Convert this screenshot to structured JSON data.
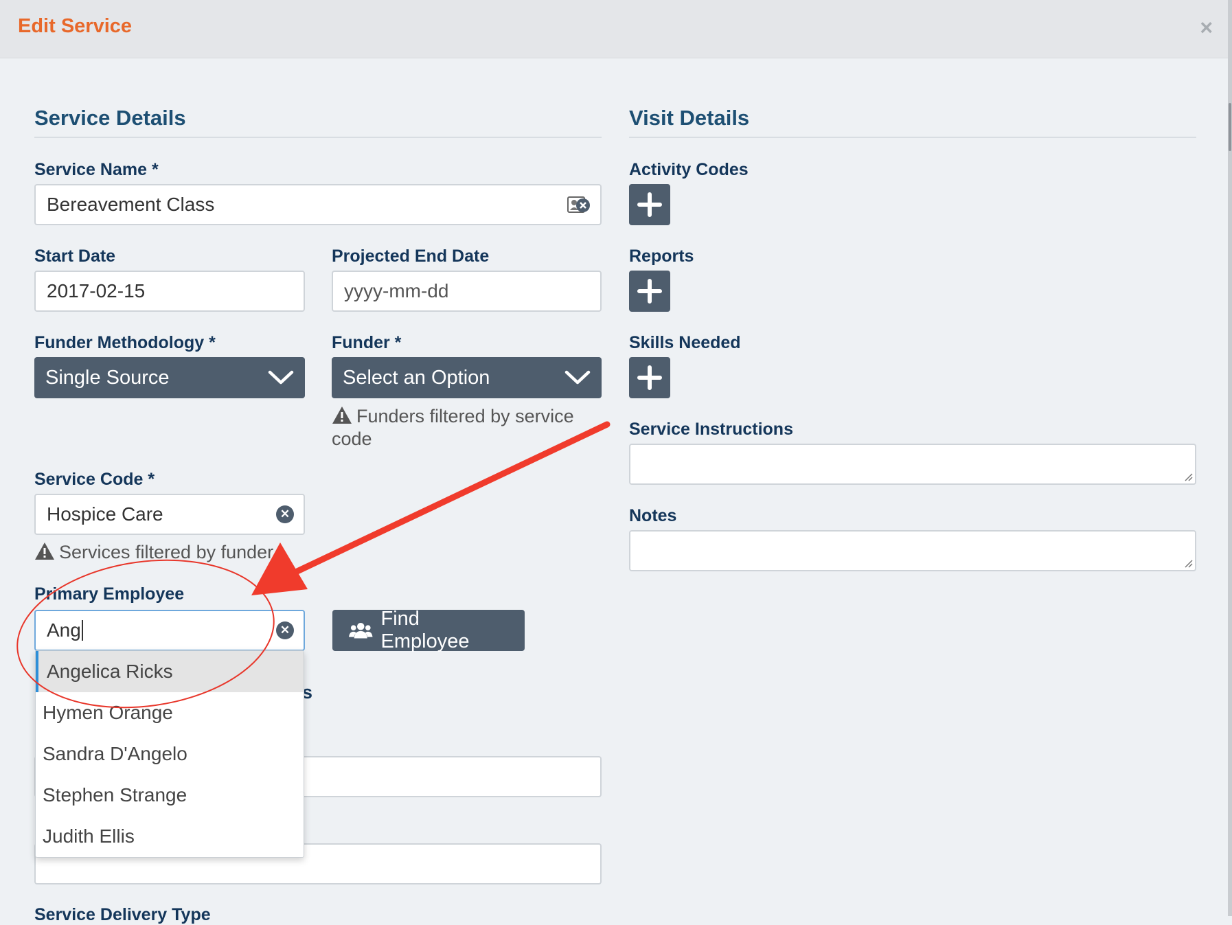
{
  "modal": {
    "title": "Edit Service",
    "close_icon": "close-icon",
    "close_symbol": "×"
  },
  "service_details": {
    "heading": "Service Details",
    "service_name": {
      "label": "Service Name *",
      "value": "Bereavement Class"
    },
    "start_date": {
      "label": "Start Date",
      "value": "2017-02-15"
    },
    "projected_end_date": {
      "label": "Projected End Date",
      "placeholder": "yyyy-mm-dd"
    },
    "funder_methodology": {
      "label": "Funder Methodology *",
      "value": "Single Source"
    },
    "funder": {
      "label": "Funder *",
      "value": "Select an Option",
      "hint": "Funders filtered by service code"
    },
    "service_code": {
      "label": "Service Code *",
      "value": "Hospice Care",
      "hint": "Services filtered by funder"
    },
    "primary_employee": {
      "label": "Primary Employee",
      "value": "Ang",
      "find_button": "Find Employee",
      "suggestions": [
        "Angelica Ricks",
        "Hymen Orange",
        "Sandra D'Angelo",
        "Stephen Strange",
        "Judith Ellis"
      ],
      "active_index": 0,
      "obscured_label_tail": "s"
    },
    "service_delivery_type": {
      "label": "Service Delivery Type"
    }
  },
  "visit_details": {
    "heading": "Visit Details",
    "activity_codes": {
      "label": "Activity Codes"
    },
    "reports": {
      "label": "Reports"
    },
    "skills_needed": {
      "label": "Skills Needed"
    },
    "service_instructions": {
      "label": "Service Instructions"
    },
    "notes": {
      "label": "Notes"
    }
  },
  "colors": {
    "accent_title": "#e8682a",
    "heading": "#1d4f73",
    "label": "#14365a",
    "button": "#4e5d6d",
    "annotation": "#e8362a"
  }
}
